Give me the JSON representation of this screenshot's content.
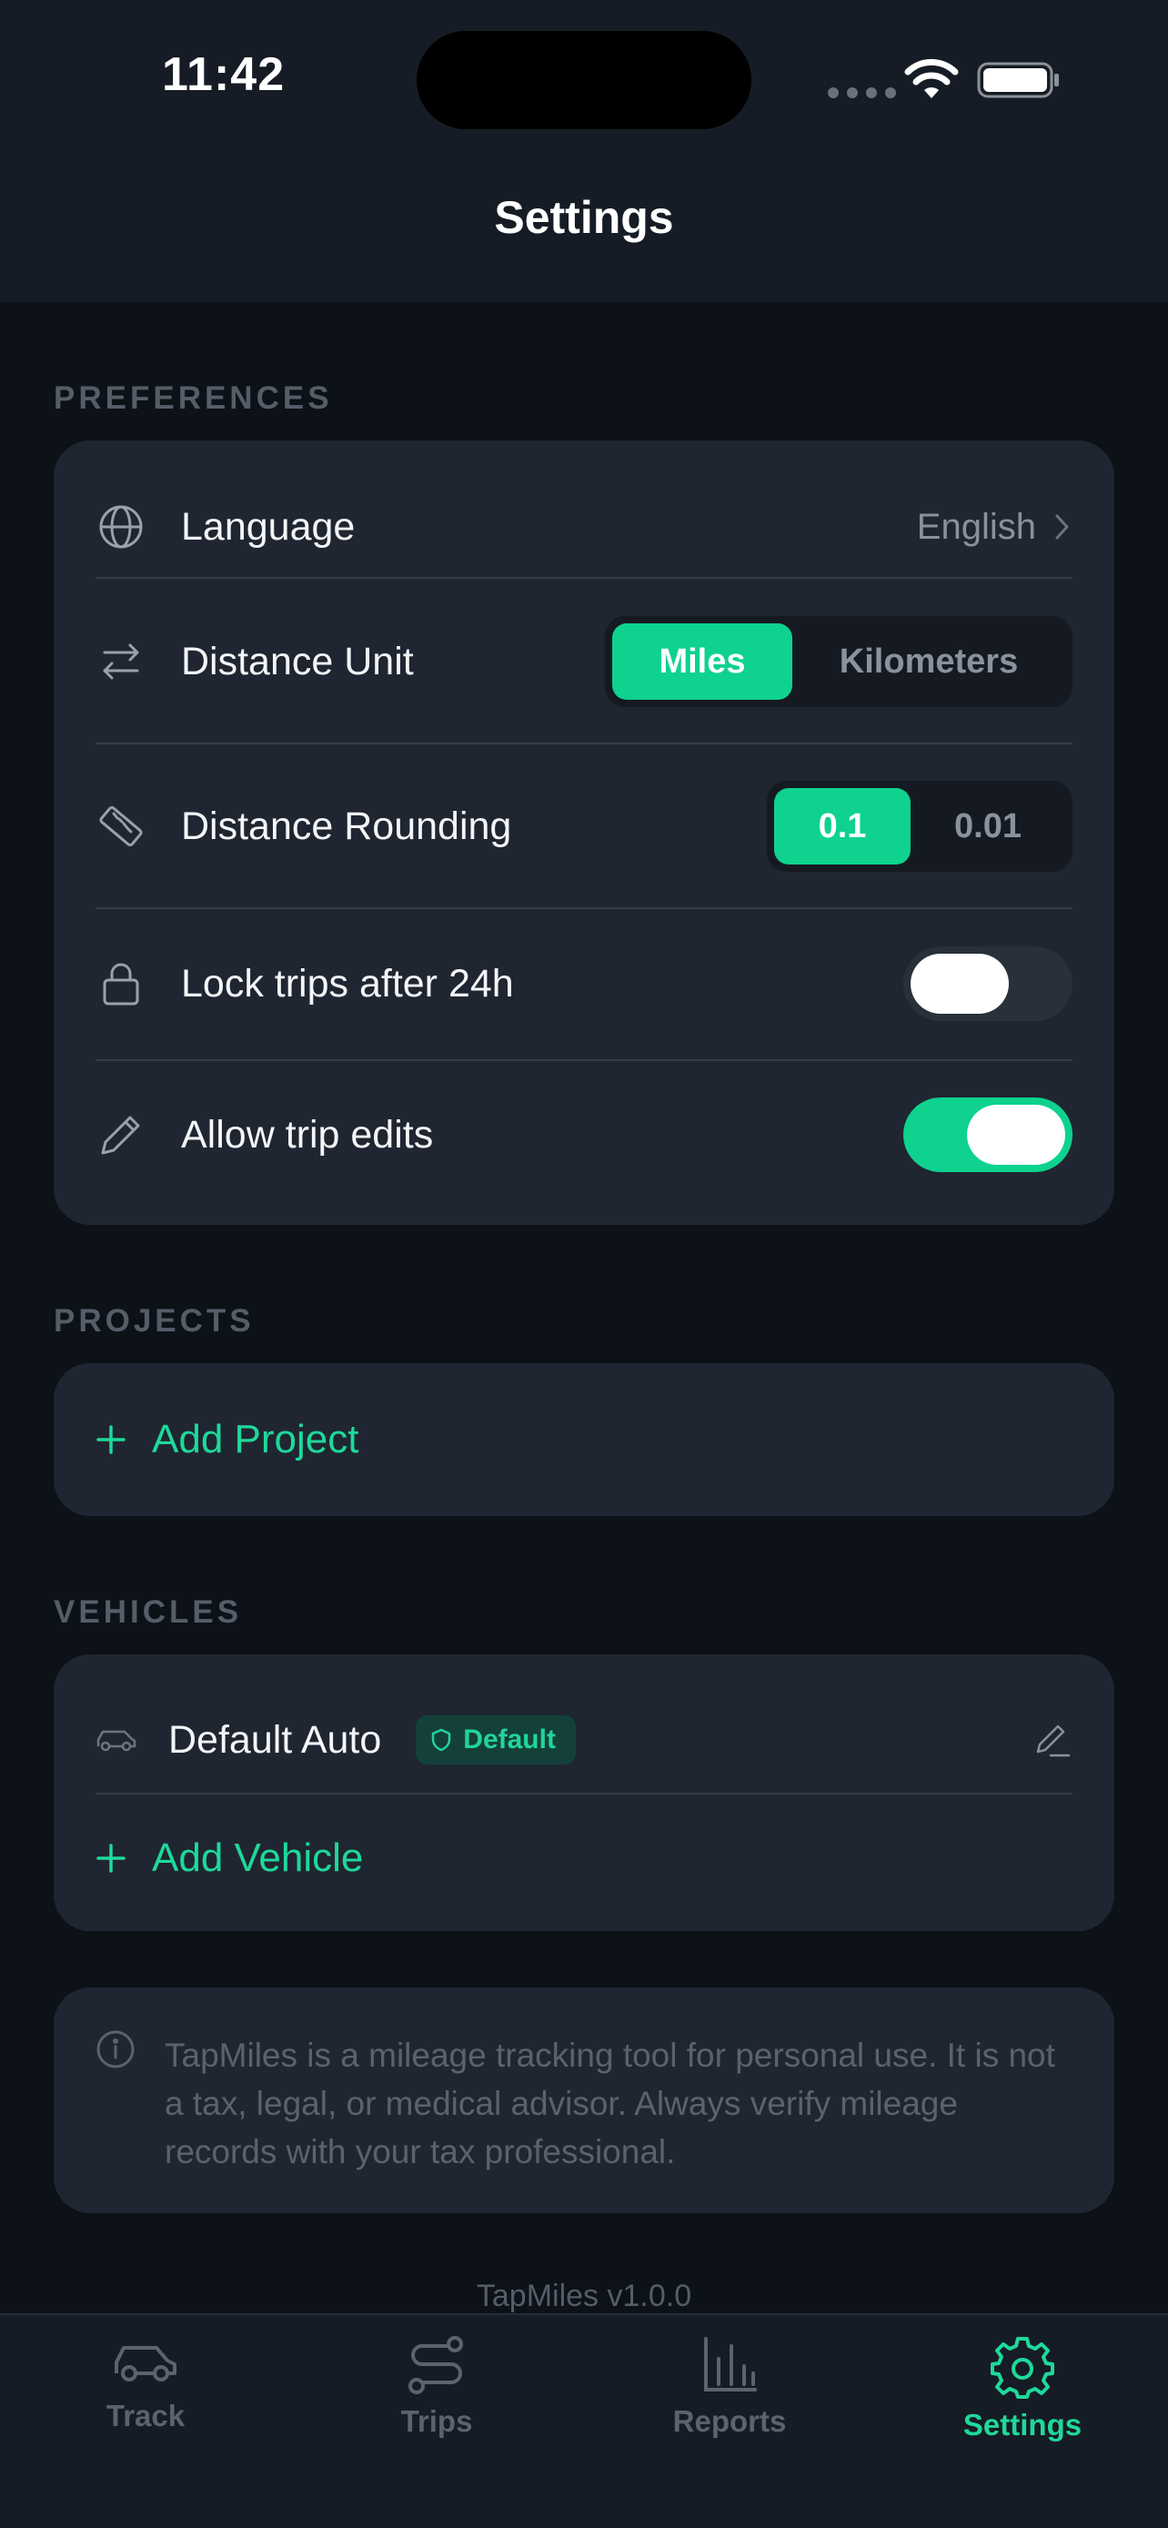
{
  "status_bar": {
    "time": "11:42"
  },
  "header": {
    "title": "Settings"
  },
  "preferences": {
    "section_label": "PREFERENCES",
    "language": {
      "label": "Language",
      "value": "English"
    },
    "distance_unit": {
      "label": "Distance Unit",
      "options": [
        "Miles",
        "Kilometers"
      ],
      "selected": "Miles"
    },
    "distance_rounding": {
      "label": "Distance Rounding",
      "options": [
        "0.1",
        "0.01"
      ],
      "selected": "0.1"
    },
    "lock_trips": {
      "label": "Lock trips after 24h",
      "enabled": false
    },
    "allow_edits": {
      "label": "Allow trip edits",
      "enabled": true
    }
  },
  "projects": {
    "section_label": "PROJECTS",
    "add_label": "Add Project"
  },
  "vehicles": {
    "section_label": "VEHICLES",
    "items": [
      {
        "name": "Default Auto",
        "badge": "Default"
      }
    ],
    "add_label": "Add Vehicle"
  },
  "disclaimer": "TapMiles is a mileage tracking tool for personal use. It is not a tax, legal, or medical advisor. Always verify mileage records with your tax professional.",
  "version": "TapMiles v1.0.0",
  "tabs": [
    {
      "label": "Track",
      "icon": "car-icon",
      "active": false
    },
    {
      "label": "Trips",
      "icon": "route-icon",
      "active": false
    },
    {
      "label": "Reports",
      "icon": "bar-chart-icon",
      "active": false
    },
    {
      "label": "Settings",
      "icon": "gear-icon",
      "active": true
    }
  ],
  "colors": {
    "accent": "#0ed28e",
    "background": "#0d1118",
    "card": "#1f2631",
    "muted": "#555d69"
  }
}
